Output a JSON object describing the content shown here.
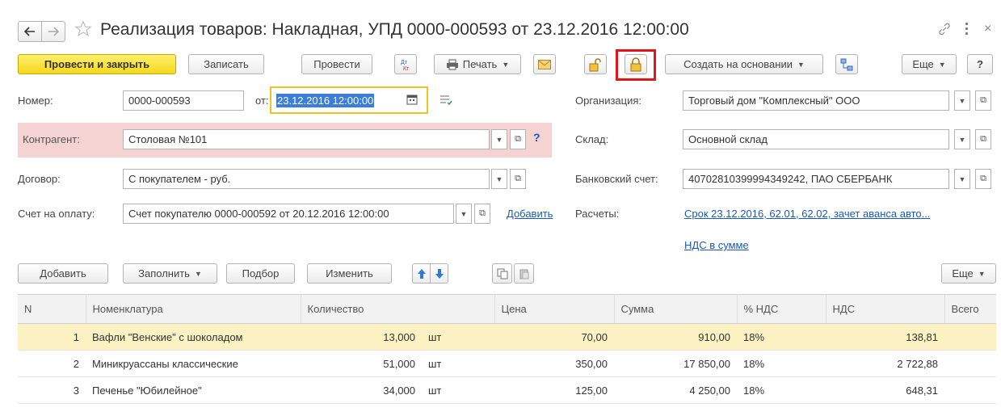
{
  "window": {
    "title": "Реализация товаров: Накладная, УПД 0000-000593 от 23.12.2016 12:00:00"
  },
  "toolbar": {
    "post_close": "Провести и закрыть",
    "save": "Записать",
    "post": "Провести",
    "dtkt": "Дт\nКт",
    "print": "Печать",
    "create_based": "Создать на основании",
    "more": "Еще",
    "help": "?"
  },
  "form": {
    "number_label": "Номер:",
    "number_value": "0000-000593",
    "from_label": "от:",
    "date_value": "23.12.2016 12:00:00",
    "org_label": "Организация:",
    "org_value": "Торговый дом \"Комплексный\" ООО",
    "contractor_label": "Контрагент:",
    "contractor_value": "Столовая №101",
    "contractor_help": "?",
    "warehouse_label": "Склад:",
    "warehouse_value": "Основной склад",
    "contract_label": "Договор:",
    "contract_value": "С покупателем - руб.",
    "bank_label": "Банковский счет:",
    "bank_value": "40702810399994349242, ПАО СБЕРБАНК",
    "invoice_label": "Счет на оплату:",
    "invoice_value": "Счет покупателю 0000-000592 от 20.12.2016 12:00:00",
    "invoice_add": "Добавить",
    "settlements_label": "Расчеты:",
    "settlements_link": "Срок 23.12.2016, 62.01, 62.02, зачет аванса авто...",
    "vat_link": "НДС в сумме"
  },
  "table_toolbar": {
    "add": "Добавить",
    "fill": "Заполнить",
    "pick": "Подбор",
    "change": "Изменить",
    "more": "Еще"
  },
  "table": {
    "headers": [
      "N",
      "Номенклатура",
      "Количество",
      "Цена",
      "Сумма",
      "% НДС",
      "НДС",
      "Всего"
    ],
    "rows": [
      {
        "n": "1",
        "name": "Вафли \"Венские\" с шоколадом",
        "qty": "13,000",
        "unit": "шт",
        "price": "70,00",
        "sum": "910,00",
        "vat_rate": "18%",
        "vat": "138,81",
        "total": ""
      },
      {
        "n": "2",
        "name": "Миникруассаны классические",
        "qty": "51,000",
        "unit": "шт",
        "price": "350,00",
        "sum": "17 850,00",
        "vat_rate": "18%",
        "vat": "2 722,88",
        "total": ""
      },
      {
        "n": "3",
        "name": "Печенье \"Юбилейное\"",
        "qty": "34,000",
        "unit": "шт",
        "price": "125,00",
        "sum": "4 250,00",
        "vat_rate": "18%",
        "vat": "648,31",
        "total": ""
      }
    ]
  },
  "colors": {
    "primary_button": "#f5d81e",
    "highlight_red": "#e0161b",
    "contractor_bg": "#f6d3d3",
    "selected_row": "#fcf1c2",
    "link": "#1a5ab8",
    "date_focus": "#f0c325"
  }
}
